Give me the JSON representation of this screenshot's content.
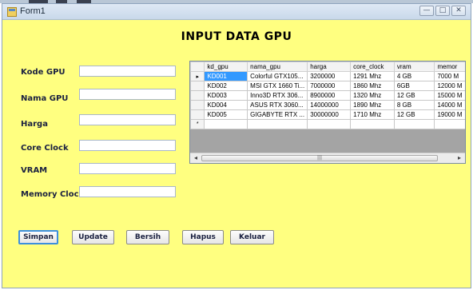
{
  "window": {
    "title": "Form1",
    "buttons": [
      "—",
      "□",
      "✕"
    ]
  },
  "form": {
    "heading": "INPUT DATA GPU",
    "fields": [
      {
        "label": "Kode GPU",
        "value": ""
      },
      {
        "label": "Nama GPU",
        "value": ""
      },
      {
        "label": "Harga",
        "value": ""
      },
      {
        "label": "Core Clock",
        "value": ""
      },
      {
        "label": "VRAM",
        "value": ""
      },
      {
        "label": "Memory Clock",
        "value": ""
      }
    ]
  },
  "grid": {
    "columns": [
      "kd_gpu",
      "nama_gpu",
      "harga",
      "core_clock",
      "vram",
      "memor"
    ],
    "rows": [
      [
        "KD001",
        "Colorful GTX105...",
        "3200000",
        "1291 Mhz",
        "4 GB",
        "7000 M"
      ],
      [
        "KD002",
        "MSI GTX 1660 Ti...",
        "7000000",
        "1860 Mhz",
        "6GB",
        "12000 M"
      ],
      [
        "KD003",
        "Inno3D RTX 306...",
        "8900000",
        "1320 Mhz",
        "12 GB",
        "15000 M"
      ],
      [
        "KD004",
        "ASUS RTX 3060...",
        "14000000",
        "1890 Mhz",
        "8 GB",
        "14000 M"
      ],
      [
        "KD005",
        "GIGABYTE RTX ...",
        "30000000",
        "1710 Mhz",
        "12 GB",
        "19000 M"
      ]
    ],
    "selected_row": 0,
    "current_row_marker": "▸",
    "new_row_marker": "*",
    "scroll_left": "◂",
    "scroll_right": "▸",
    "scroll_grip": "|||"
  },
  "actions": {
    "simpan": "Simpan",
    "update": "Update",
    "bersih": "Bersih",
    "hapus": "Hapus",
    "keluar": "Keluar"
  },
  "colors": {
    "form_background": "#ffff80",
    "selection": "#3399ff"
  }
}
